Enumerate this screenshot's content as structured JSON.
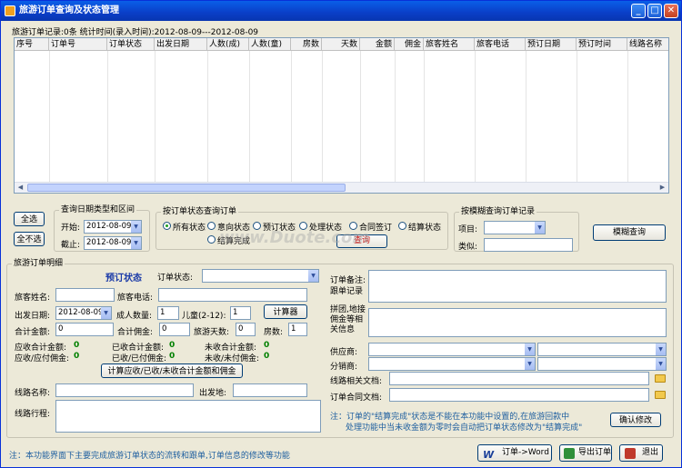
{
  "title": "旅游订单查询及状态管理",
  "title_buttons": [
    "_",
    "□",
    "✕"
  ],
  "summary": "旅游订单记录:0条  统计时间(录入时间):2012-08-09---2012-08-09",
  "columns": [
    "序号",
    "订单号",
    "订单状态",
    "出发日期",
    "人数(成)",
    "人数(童)",
    "房数",
    "天数",
    "金额",
    "佣金",
    "旅客姓名",
    "旅客电话",
    "预订日期",
    "预订时间",
    "线路名称"
  ],
  "select_all": "全选",
  "select_none": "全不选",
  "date_group": {
    "title": "查询日期类型和区间",
    "start_label": "开始:",
    "start": "2012-08-09",
    "end_label": "截止:",
    "end": "2012-08-09"
  },
  "status_group": {
    "title": "按订单状态查询订单",
    "options": [
      "所有状态",
      "意向状态",
      "预订状态",
      "处理状态",
      "合同签订",
      "结算状态",
      "结算完成"
    ],
    "query": "查询"
  },
  "fuzzy_group": {
    "title": "按模糊查询订单记录",
    "item_label": "项目:",
    "like_label": "类似:",
    "button": "模糊查询"
  },
  "detail": {
    "title": "旅游订单明细",
    "state_display": "预订状态",
    "status_label": "订单状态:",
    "name_label": "旅客姓名:",
    "phone_label": "旅客电话:",
    "date_label": "出发日期:",
    "date": "2012-08-09",
    "adult_label": "成人数量:",
    "adult": "1",
    "child_label": "儿童(2-12):",
    "child": "1",
    "calc": "计算器",
    "total_label": "合计金额:",
    "total": "0",
    "comm_label": "合计佣金:",
    "comm": "0",
    "days_label": "旅游天数:",
    "days": "0",
    "rooms_label": "房数:",
    "rooms": "1",
    "ar_total_label": "应收合计金额:",
    "ar_total": "0",
    "recv_total_label": "已收合计金额:",
    "recv_total": "0",
    "unrecv_total_label": "未收合计金额:",
    "unrecv_total": "0",
    "ap_comm_label": "应收/应付佣金:",
    "ap_comm": "0",
    "paid_comm_label": "已收/已付佣金:",
    "paid_comm": "0",
    "unpaid_comm_label": "未收/未付佣金:",
    "unpaid_comm": "0",
    "calc_all": "计算应收/已收/未收合计金额和佣金",
    "route_label": "线路名称:",
    "dep_label": "出发地:",
    "itin_label": "线路行程:"
  },
  "right": {
    "remark_label": "订单备注:",
    "follow_label": "跟单记录",
    "group_label": "拼团,地接佣金等相关信息",
    "supplier_label": "供应商:",
    "dist_label": "分销商:",
    "route_doc_label": "线路相关文档:",
    "contract_doc_label": "订单合同文档:",
    "note": "注：订单的\"结算完成\"状态是不能在本功能中设置的,在旅游回款中",
    "note2": "处理功能中当未收金额为零时会自动把订单状态修改为\"结算完成\"",
    "confirm": "确认修改"
  },
  "footer": {
    "note": "注：本功能界面下主要完成旅游订单状态的流转和跟单,订单信息的修改等功能",
    "word": "订单->Word",
    "export": "导出订单",
    "exit": "退出"
  },
  "watermark": "www.Duote.com"
}
